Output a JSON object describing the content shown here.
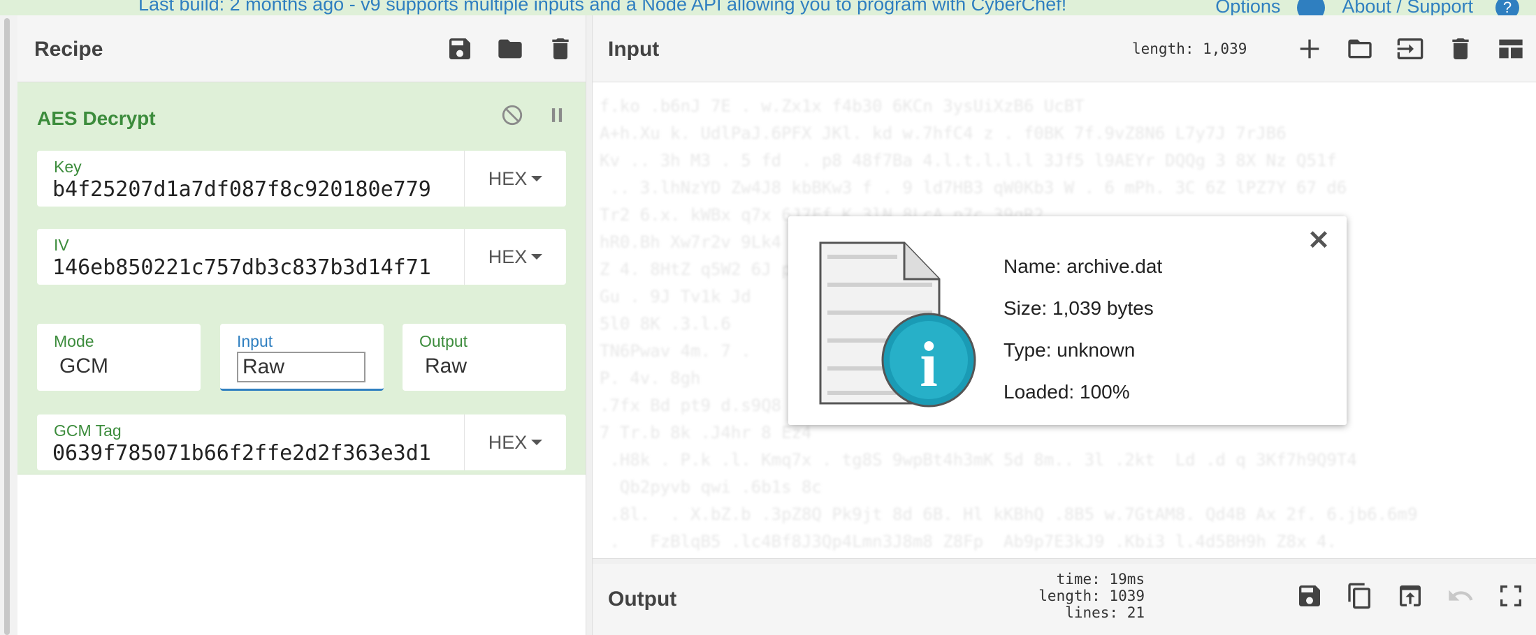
{
  "banner": {
    "message": "Last build: 2 months ago - v9 supports multiple inputs and a Node API allowing you to program with CyberChef!",
    "options_label": "Options",
    "about_label": "About / Support",
    "help_glyph": "?"
  },
  "recipe": {
    "title": "Recipe",
    "icons": [
      "save-icon",
      "folder-icon",
      "trash-icon"
    ],
    "operation": {
      "name": "AES Decrypt",
      "icons": [
        "disable-icon",
        "pause-icon"
      ],
      "key": {
        "label": "Key",
        "value": "b4f25207d1a7df087f8c920180e779",
        "format": "HEX"
      },
      "iv": {
        "label": "IV",
        "value": "146eb850221c757db3c837b3d14f71",
        "format": "HEX"
      },
      "mode": {
        "label": "Mode",
        "value": "GCM"
      },
      "input": {
        "label": "Input",
        "value": "Raw"
      },
      "output": {
        "label": "Output",
        "value": "Raw"
      },
      "gcm_tag": {
        "label": "GCM Tag",
        "value": "0639f785071b66f2ffe2d2f363e3d1",
        "format": "HEX"
      }
    }
  },
  "input": {
    "title": "Input",
    "length_text": "length: 1,039",
    "icons": [
      "add-icon",
      "folder-icon",
      "load-icon",
      "trash-icon",
      "layout-icon"
    ]
  },
  "file_popup": {
    "name": "Name: archive.dat",
    "size": "Size: 1,039 bytes",
    "type": "Type: unknown",
    "loaded": "Loaded: 100%",
    "close_glyph": "✕",
    "info_glyph": "i"
  },
  "output": {
    "title": "Output",
    "time": "time: 19ms",
    "length": "length: 1039",
    "lines": "lines:   21",
    "icons": [
      "save-icon",
      "copy-icon",
      "open-in-input-icon",
      "undo-icon",
      "fullscreen-icon"
    ]
  },
  "colors": {
    "accent": "#2f7fc0",
    "op_background": "#dff0d8",
    "op_text": "#3c8c3c",
    "info_circle": "#1a9bb5"
  }
}
